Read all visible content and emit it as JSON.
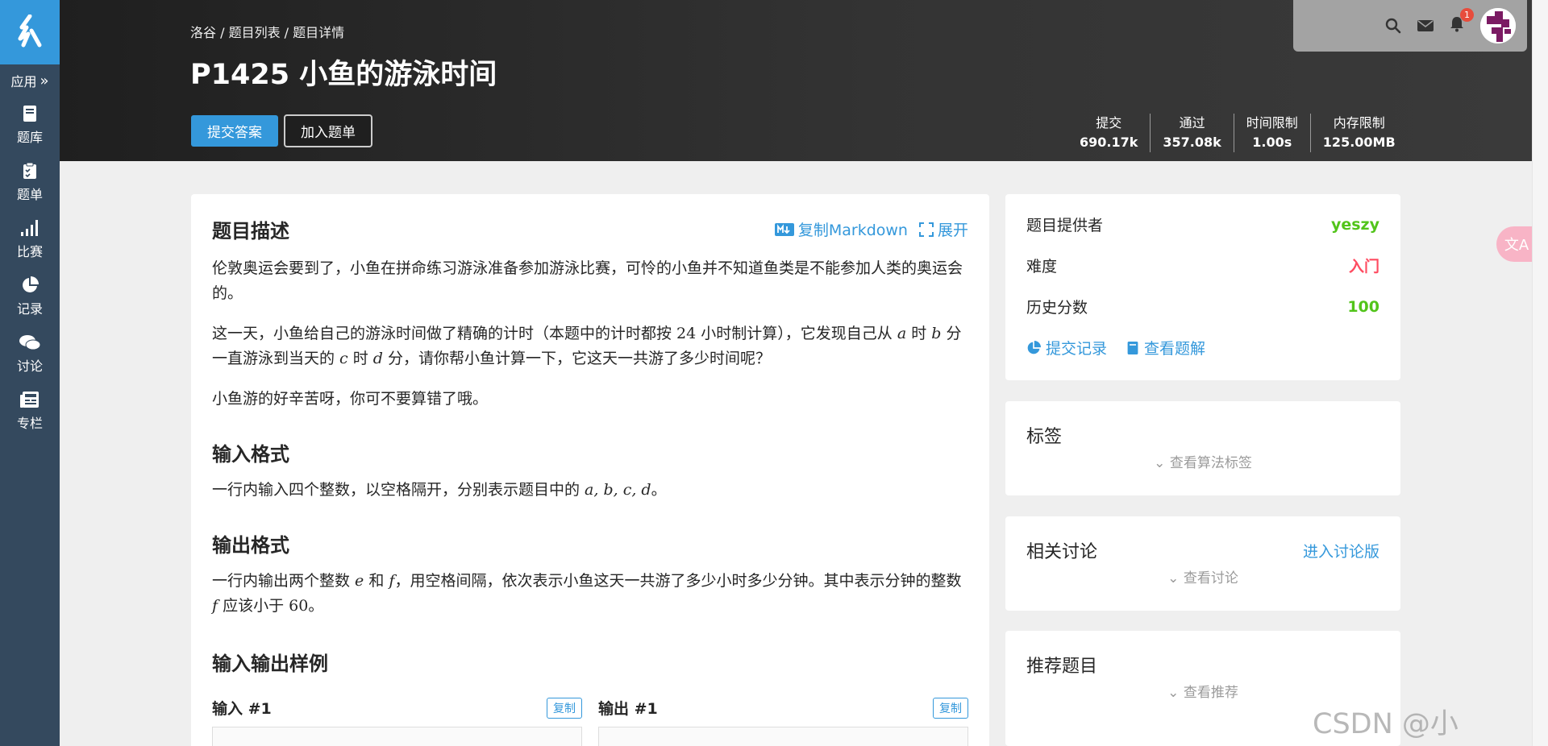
{
  "sidebar": {
    "apps_label": "应用",
    "items": [
      {
        "label": "题库",
        "icon": "book-icon"
      },
      {
        "label": "题单",
        "icon": "clipboard-icon"
      },
      {
        "label": "比赛",
        "icon": "bar-chart-icon"
      },
      {
        "label": "记录",
        "icon": "pie-chart-icon"
      },
      {
        "label": "讨论",
        "icon": "chat-icon"
      },
      {
        "label": "专栏",
        "icon": "newspaper-icon"
      }
    ]
  },
  "header": {
    "breadcrumb": "洛谷 / 题目列表 / 题目详情",
    "title": "P1425 小鱼的游泳时间",
    "submit_label": "提交答案",
    "add_label": "加入题单",
    "stats": [
      {
        "label": "提交",
        "value": "690.17k"
      },
      {
        "label": "通过",
        "value": "357.08k"
      },
      {
        "label": "时间限制",
        "value": "1.00s"
      },
      {
        "label": "内存限制",
        "value": "125.00MB"
      }
    ],
    "notification_count": "1"
  },
  "problem": {
    "desc_title": "题目描述",
    "copy_markdown": "复制Markdown",
    "expand": "展开",
    "para1": "伦敦奥运会要到了，小鱼在拼命练习游泳准备参加游泳比赛，可怜的小鱼并不知道鱼类是不能参加人类的奥运会的。",
    "para2_a": "这一天，小鱼给自己的游泳时间做了精确的计时（本题中的计时都按 ",
    "para2_24": "24",
    "para2_b": " 小时制计算），它发现自己从 ",
    "para2_var_a": "a",
    "para2_c": " 时 ",
    "para2_var_b": "b",
    "para2_d": " 分一直游泳到当天的 ",
    "para2_var_c": "c",
    "para2_e": " 时 ",
    "para2_var_d": "d",
    "para2_f": " 分，请你帮小鱼计算一下，它这天一共游了多少时间呢？",
    "para3": "小鱼游的好辛苦呀，你可不要算错了哦。",
    "input_title": "输入格式",
    "input_a": "一行内输入四个整数，以空格隔开，分别表示题目中的 ",
    "input_vars": "a, b, c, d",
    "input_b": "。",
    "output_title": "输出格式",
    "output_a": "一行内输出两个整数 ",
    "output_var_e": "e",
    "output_b": " 和 ",
    "output_var_f": "f",
    "output_c": "，用空格间隔，依次表示小鱼这天一共游了多少小时多少分钟。其中表示分钟的整数 ",
    "output_var_f2": "f",
    "output_d": " 应该小于 ",
    "output_60": "60",
    "output_e": "。",
    "sample_title": "输入输出样例",
    "sample_in": "输入 #1",
    "sample_out": "输出 #1",
    "copy_label": "复制"
  },
  "info": {
    "provider_label": "题目提供者",
    "provider": "yeszy",
    "difficulty_label": "难度",
    "difficulty": "入门",
    "score_label": "历史分数",
    "score": "100",
    "records_link": "提交记录",
    "solutions_link": "查看题解"
  },
  "tags": {
    "title": "标签",
    "more": "查看算法标签"
  },
  "discuss": {
    "title": "相关讨论",
    "link": "进入讨论版",
    "more": "查看讨论"
  },
  "recommend": {
    "title": "推荐题目",
    "more": "查看推荐"
  },
  "watermark": "CSDN @小",
  "colors": {
    "accent": "#3498db",
    "provider": "#52c41a",
    "difficulty": "#fe4c61",
    "sidebar": "#34495e"
  }
}
